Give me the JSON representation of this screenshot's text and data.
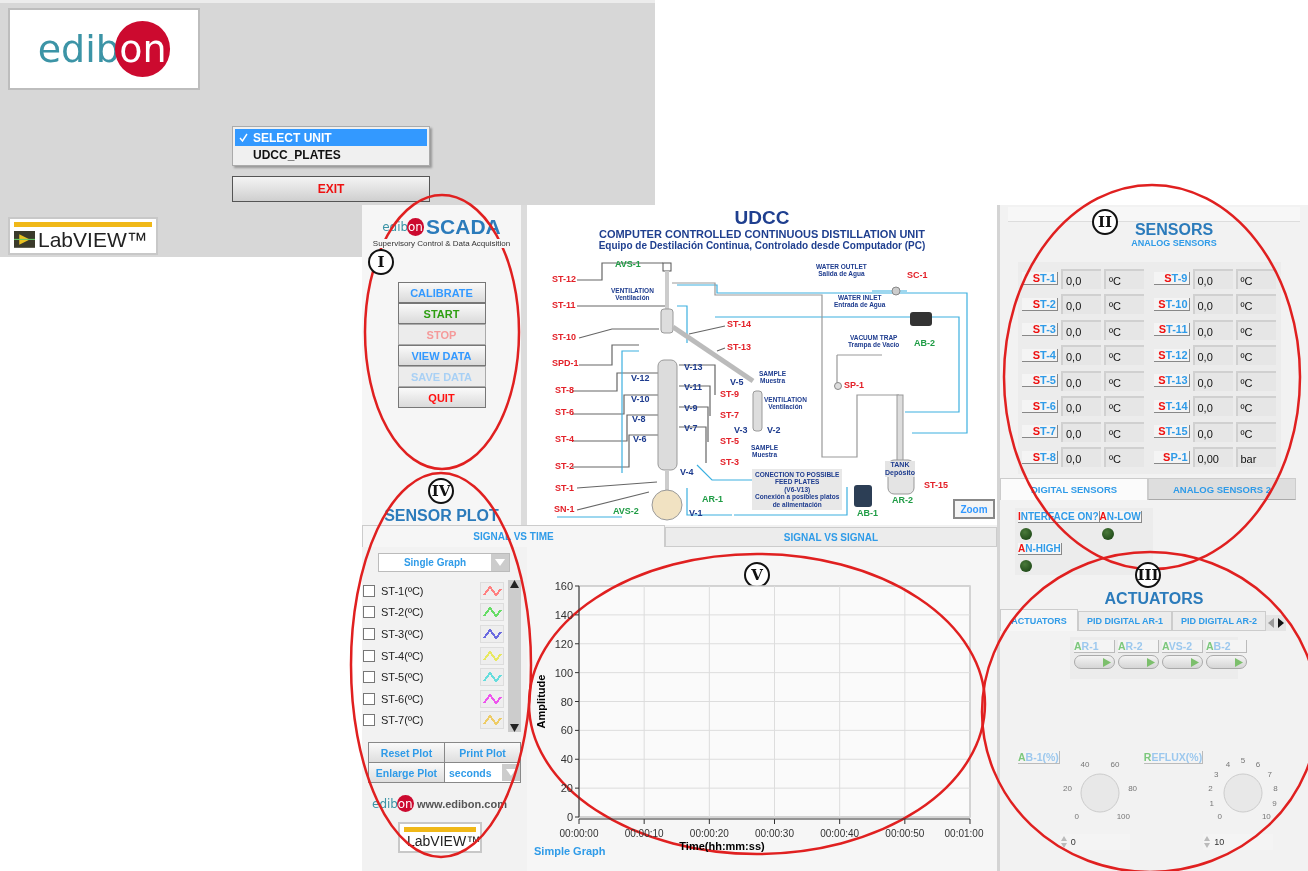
{
  "launcher": {
    "logo": {
      "text": "edib",
      "circle_text": "on"
    },
    "unit_list": [
      {
        "label": "SELECT UNIT",
        "selected": true
      },
      {
        "label": "UDCC_PLATES",
        "selected": false
      }
    ],
    "exit_button": "EXIT",
    "labview_logo": "LabVIEW™"
  },
  "scada": {
    "logo": {
      "text": "edib",
      "circle_text": "on"
    },
    "title": "SCADA",
    "subtitle": "Supervisory Control & Data Acquisition",
    "controls": [
      {
        "label": "CALIBRATE",
        "color": "#3399ff",
        "disabled": false
      },
      {
        "label": "START",
        "color": "#2e9e12",
        "disabled": false
      },
      {
        "label": "STOP",
        "color": "#f59a9a",
        "disabled": true
      },
      {
        "label": "VIEW DATA",
        "color": "#3399ff",
        "disabled": false
      },
      {
        "label": "SAVE DATA",
        "color": "#a8d0f5",
        "disabled": true
      },
      {
        "label": "QUIT",
        "color": "#ff1010",
        "disabled": false
      }
    ]
  },
  "diagram": {
    "title": "UDCC",
    "subtitle": "COMPUTER CONTROLLED CONTINUOUS DISTILLATION UNIT",
    "subtitle_es": "Equipo de Destilación Continua, Controlado desde Computador (PC)",
    "labels": [
      {
        "text": "AVS-1",
        "kind": "actuator"
      },
      {
        "text": "ST-12",
        "kind": "sensor"
      },
      {
        "text": "ST-11",
        "kind": "sensor"
      },
      {
        "text": "ST-10",
        "kind": "sensor"
      },
      {
        "text": "SPD-1",
        "kind": "sensor"
      },
      {
        "text": "ST-8",
        "kind": "sensor"
      },
      {
        "text": "ST-6",
        "kind": "sensor"
      },
      {
        "text": "ST-4",
        "kind": "sensor"
      },
      {
        "text": "ST-2",
        "kind": "sensor"
      },
      {
        "text": "ST-1",
        "kind": "sensor"
      },
      {
        "text": "SN-1",
        "kind": "sensor"
      },
      {
        "text": "V-12",
        "kind": "valve"
      },
      {
        "text": "V-10",
        "kind": "valve"
      },
      {
        "text": "V-8",
        "kind": "valve"
      },
      {
        "text": "V-6",
        "kind": "valve"
      },
      {
        "text": "V-13",
        "kind": "valve"
      },
      {
        "text": "V-11",
        "kind": "valve"
      },
      {
        "text": "V-9",
        "kind": "valve"
      },
      {
        "text": "V-7",
        "kind": "valve"
      },
      {
        "text": "V-4",
        "kind": "valve"
      },
      {
        "text": "AR-1",
        "kind": "actuator"
      },
      {
        "text": "AVS-2",
        "kind": "actuator"
      },
      {
        "text": "V-1",
        "kind": "valve"
      },
      {
        "text": "ST-14",
        "kind": "sensor"
      },
      {
        "text": "ST-13",
        "kind": "sensor"
      },
      {
        "text": "ST-9",
        "kind": "sensor"
      },
      {
        "text": "ST-7",
        "kind": "sensor"
      },
      {
        "text": "ST-5",
        "kind": "sensor"
      },
      {
        "text": "ST-3",
        "kind": "sensor"
      },
      {
        "text": "V-5",
        "kind": "valve"
      },
      {
        "text": "V-3",
        "kind": "valve"
      },
      {
        "text": "V-2",
        "kind": "valve"
      },
      {
        "text": "SC-1",
        "kind": "sensor"
      },
      {
        "text": "AB-2",
        "kind": "actuator"
      },
      {
        "text": "SP-1",
        "kind": "sensor"
      },
      {
        "text": "AR-2",
        "kind": "actuator"
      },
      {
        "text": "ST-15",
        "kind": "sensor"
      },
      {
        "text": "AB-1",
        "kind": "actuator"
      }
    ],
    "notes": [
      {
        "text": "WATER OUTLET\nSalida de Agua",
        "kind": "plain"
      },
      {
        "text": "VENTILATION\nVentilación",
        "kind": "plain"
      },
      {
        "text": "WATER INLET\nEntrada de Agua",
        "kind": "plain"
      },
      {
        "text": "VACUUM TRAP\nTrampa de Vacío",
        "kind": "plain"
      },
      {
        "text": "SAMPLE\nMuestra",
        "kind": "plain"
      },
      {
        "text": "VENTILATION\nVentilación",
        "kind": "plain"
      },
      {
        "text": "SAMPLE\nMuestra",
        "kind": "plain"
      },
      {
        "text": "CONECTION TO POSSIBLE\nFEED PLATES\n(V6-V13)\nConexión a posibles platos\nde alimentación",
        "kind": "boxed"
      },
      {
        "text": "TANK\nDepósito",
        "kind": "tiny"
      }
    ],
    "zoom_button": "Zoom"
  },
  "sensor_plot": {
    "title": "SENSOR PLOT",
    "tabs": [
      {
        "label": "SIGNAL VS TIME",
        "selected": true
      },
      {
        "label": "SIGNAL VS SIGNAL",
        "selected": false
      }
    ],
    "mode": "Single Graph",
    "channels": [
      {
        "label": "ST-1(ºC)",
        "checked": false,
        "color": "#ff8080"
      },
      {
        "label": "ST-2(ºC)",
        "checked": false,
        "color": "#66dd66"
      },
      {
        "label": "ST-3(ºC)",
        "checked": false,
        "color": "#6a6ae0"
      },
      {
        "label": "ST-4(ºC)",
        "checked": false,
        "color": "#e8e860"
      },
      {
        "label": "ST-5(ºC)",
        "checked": false,
        "color": "#66dddd"
      },
      {
        "label": "ST-6(ºC)",
        "checked": false,
        "color": "#ee55ee"
      },
      {
        "label": "ST-7(ºC)",
        "checked": false,
        "color": "#eecc66"
      }
    ],
    "buttons": [
      "Reset Plot",
      "Print Plot",
      "Enlarge Plot"
    ],
    "time_unit": "seconds",
    "website": "www.edibon.com",
    "website_logo": {
      "text": "edib",
      "circle_text": "on"
    },
    "labview_logo": "LabVIEW™",
    "graph_caption": "Simple Graph",
    "chart_data": {
      "type": "line",
      "grid": true,
      "xlabel": "Time(hh:mm:ss)",
      "ylabel": "Amplitude",
      "xlim": [
        0,
        60
      ],
      "ylim": [
        0,
        160
      ],
      "xticks": [
        {
          "value": 0,
          "label": "00:00:00"
        },
        {
          "value": 10,
          "label": "00:00:10"
        },
        {
          "value": 20,
          "label": "00:00:20"
        },
        {
          "value": 30,
          "label": "00:00:30"
        },
        {
          "value": 40,
          "label": "00:00:40"
        },
        {
          "value": 50,
          "label": "00:00:50"
        },
        {
          "value": 60,
          "label": "00:01:00"
        }
      ],
      "yticks": [
        0,
        20,
        40,
        60,
        80,
        100,
        120,
        140,
        160
      ]
    }
  },
  "sensors": {
    "title": "SENSORS",
    "subtitle": "ANALOG SENSORS",
    "readings": [
      {
        "tag": "ST-1",
        "value": "0,0",
        "unit": "ºC"
      },
      {
        "tag": "ST-2",
        "value": "0,0",
        "unit": "ºC"
      },
      {
        "tag": "ST-3",
        "value": "0,0",
        "unit": "ºC"
      },
      {
        "tag": "ST-4",
        "value": "0,0",
        "unit": "ºC"
      },
      {
        "tag": "ST-5",
        "value": "0,0",
        "unit": "ºC"
      },
      {
        "tag": "ST-6",
        "value": "0,0",
        "unit": "ºC"
      },
      {
        "tag": "ST-7",
        "value": "0,0",
        "unit": "ºC"
      },
      {
        "tag": "ST-8",
        "value": "0,0",
        "unit": "ºC"
      },
      {
        "tag": "ST-9",
        "value": "0,0",
        "unit": "ºC"
      },
      {
        "tag": "ST-10",
        "value": "0,0",
        "unit": "ºC"
      },
      {
        "tag": "ST-11",
        "value": "0,0",
        "unit": "ºC"
      },
      {
        "tag": "ST-12",
        "value": "0,0",
        "unit": "ºC"
      },
      {
        "tag": "ST-13",
        "value": "0,0",
        "unit": "ºC"
      },
      {
        "tag": "ST-14",
        "value": "0,0",
        "unit": "ºC"
      },
      {
        "tag": "ST-15",
        "value": "0,0",
        "unit": "ºC"
      },
      {
        "tag": "SP-1",
        "value": "0,00",
        "unit": "bar"
      }
    ],
    "tabs": [
      {
        "label": "DIGITAL SENSORS",
        "selected": true
      },
      {
        "label": "ANALOG SENSORS 2",
        "selected": false
      }
    ],
    "indicators": [
      {
        "label": "INTERFACE ON?",
        "on": false
      },
      {
        "label": "AN-LOW",
        "on": false
      },
      {
        "label": "AN-HIGH",
        "on": false
      }
    ]
  },
  "actuators": {
    "title": "ACTUATORS",
    "tabs": [
      {
        "label": "ACTUATORS",
        "selected": true
      },
      {
        "label": "PID DIGITAL AR-1",
        "selected": false
      },
      {
        "label": "PID DIGITAL AR-2",
        "selected": false
      }
    ],
    "switches": [
      {
        "label": "AR-1",
        "on": false
      },
      {
        "label": "AR-2",
        "on": false
      },
      {
        "label": "AVS-2",
        "on": false
      },
      {
        "label": "AB-2",
        "on": false
      }
    ],
    "knobs": [
      {
        "label": "AB-1(%)",
        "scale": [
          "0",
          "20",
          "40",
          "60",
          "80",
          "100"
        ],
        "value": "0"
      },
      {
        "label": "REFLUX(%)",
        "scale": [
          "0",
          "1",
          "2",
          "3",
          "4",
          "5",
          "6",
          "7",
          "8",
          "9",
          "10"
        ],
        "value": "10"
      }
    ]
  },
  "annotations": [
    {
      "label": "I"
    },
    {
      "label": "II"
    },
    {
      "label": "III"
    },
    {
      "label": "IV"
    },
    {
      "label": "V"
    }
  ]
}
